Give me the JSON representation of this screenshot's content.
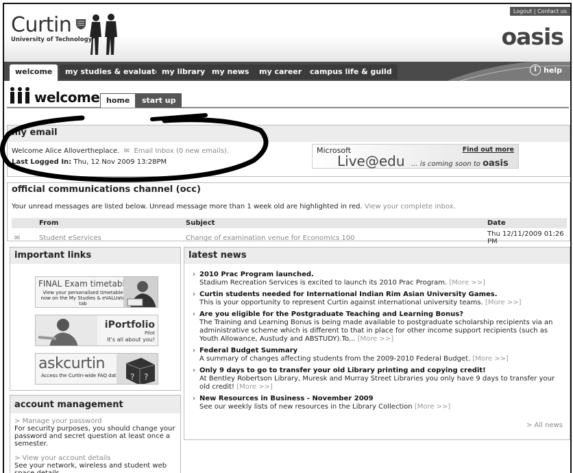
{
  "header": {
    "logo_word": "Curtin",
    "logo_sub": "University of Technology",
    "top_links": [
      "Logout",
      "Contact us"
    ],
    "brand": "oasis"
  },
  "nav": {
    "tabs": [
      {
        "label": "welcome",
        "active": true
      },
      {
        "label": "my studies & evaluate"
      },
      {
        "label": "my library"
      },
      {
        "label": "my news"
      },
      {
        "label": "my career"
      },
      {
        "label": "campus life & guild"
      }
    ],
    "help": "help",
    "help_icon": "i"
  },
  "page": {
    "title": "welcome",
    "subtabs": [
      "home",
      "start up"
    ]
  },
  "email": {
    "heading": "my email",
    "welcome_prefix": "Welcome Alice Allovertheplace.",
    "inbox_link": "Email Inbox",
    "inbox_count": "(0 new emails).",
    "last_logged_label": "Last Logged In:",
    "last_logged_value": "Thu, 12 Nov 2009 13:28PM"
  },
  "ms_banner": {
    "microsoft": "Microsoft",
    "find_out": "Find out more",
    "live": "Live@edu",
    "tail": "... is coming soon to",
    "tail_brand": "oasis"
  },
  "occ": {
    "heading": "official communications channel (occ)",
    "desc": "Your unread messages are listed below. Unread message more than 1 week old are highlighted in red.",
    "inbox_link": "View your complete inbox.",
    "columns": [
      "From",
      "Subject",
      "Date"
    ],
    "rows": [
      {
        "from": "Student eServices",
        "subject": "Change of examination venue for Economics 100",
        "date": "Thu 12/11/2009 01:26 PM"
      }
    ]
  },
  "links": {
    "heading": "important links",
    "promo1": {
      "title": "FINAL Exam timetable",
      "sub": "View your personalised timetable now on the My Studies & eVALUate tab"
    },
    "promo2": {
      "title": "iPortfolio",
      "pilot": "Pilot",
      "tag": "It's all about you!"
    },
    "promo3": {
      "title": "askcurtin",
      "sub": "Access the Curtin-wide FAQ database"
    }
  },
  "news": {
    "heading": "latest news",
    "items": [
      {
        "title": "2010 Prac Program launched.",
        "body": "Stadium Recreation Services is excited to launch its 2010 Prac Program."
      },
      {
        "title": "Curtin students needed for International Indian Rim Asian University Games.",
        "body": "This is your opportunity to represent Curtin against international university teams."
      },
      {
        "title": "Are you eligible for the Postgraduate Teaching and Learning Bonus?",
        "body": "The Training and Learning Bonus is being made available to postgraduate scholarship recipients via an administrative scheme which is different to that in place for other income support recipients (such as Youth Allowance, Austudy and ABSTUDY).To..."
      },
      {
        "title": "Federal Budget Summary",
        "body": "A summary of changes affecting students from the 2009-2010 Federal Budget."
      },
      {
        "title": "Only 9 days to go to transfer your old Library printing and copying credit!",
        "body": "At Bentley Robertson Library, Muresk and Murray Street Libraries you only have 9 days to transfer your old credit!"
      },
      {
        "title": "New Resources in Business - November 2009",
        "body": "See our weekly lists of new resources in the Library Collection"
      }
    ],
    "more": "[More >>]",
    "all_news": "> All news"
  },
  "account": {
    "heading": "account management",
    "items": [
      {
        "link": "Manage your password",
        "body": "For security purposes, you should change your password and secret question at least once a semester."
      },
      {
        "link": "View your account details",
        "body": "See your network, wireless and student web space details."
      }
    ],
    "bullet": ">"
  }
}
